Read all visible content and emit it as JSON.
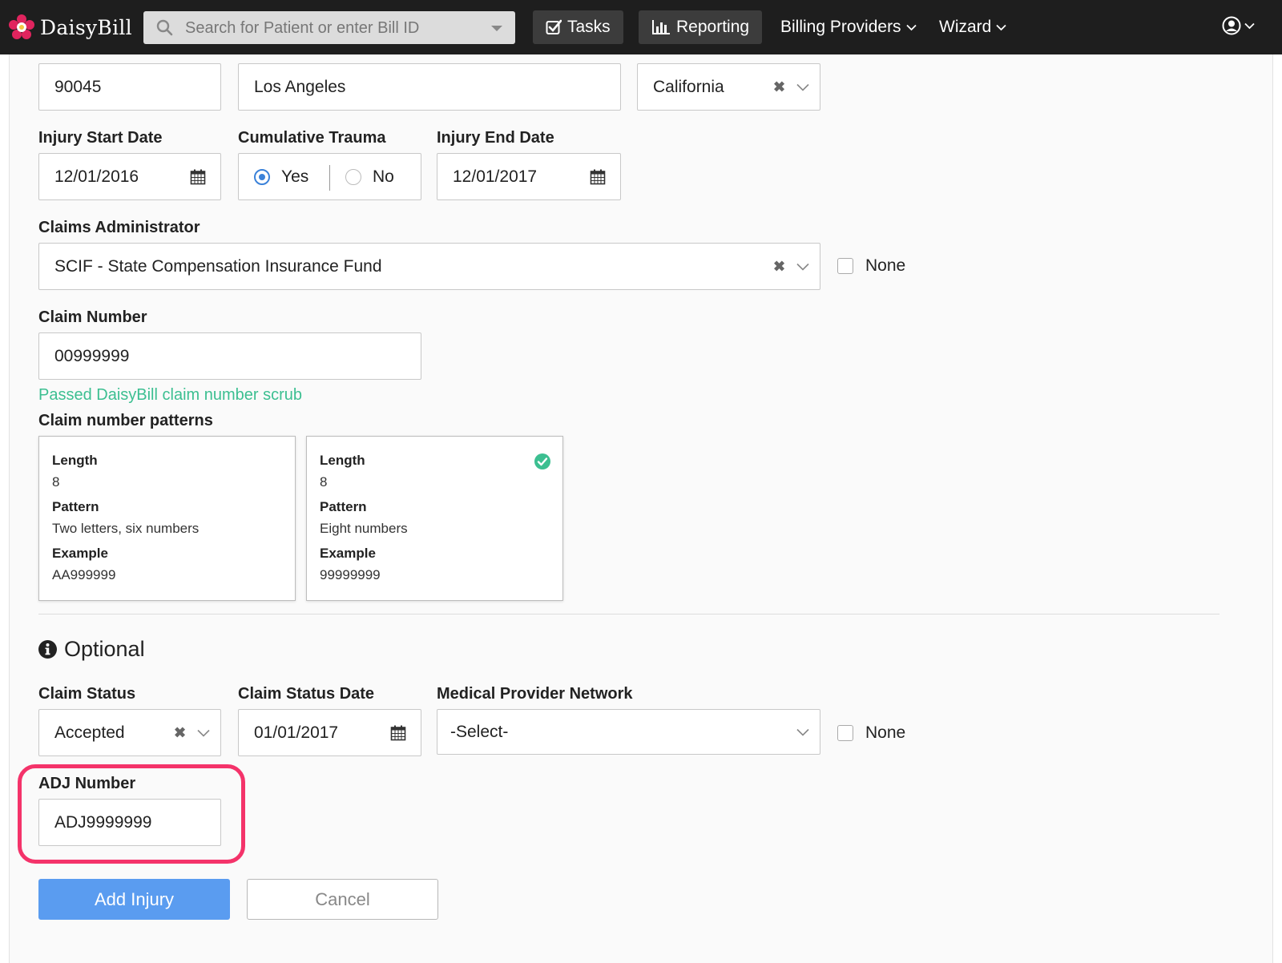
{
  "navbar": {
    "brand": "DaisyBill",
    "search_placeholder": "Search for Patient or enter Bill ID",
    "tasks_label": "Tasks",
    "reporting_label": "Reporting",
    "billing_providers_label": "Billing Providers",
    "wizard_label": "Wizard"
  },
  "address": {
    "zip": "90045",
    "city": "Los Angeles",
    "state": "California"
  },
  "injury": {
    "start_date_label": "Injury Start Date",
    "start_date": "12/01/2016",
    "cumulative_label": "Cumulative Trauma",
    "yes_label": "Yes",
    "no_label": "No",
    "end_date_label": "Injury End Date",
    "end_date": "12/01/2017"
  },
  "claims_admin": {
    "label": "Claims Administrator",
    "value": "SCIF - State Compensation Insurance Fund",
    "none_label": "None"
  },
  "claim_number": {
    "label": "Claim Number",
    "value": "00999999",
    "scrub_message": "Passed DaisyBill claim number scrub",
    "patterns_label": "Claim number patterns",
    "patterns": [
      {
        "length_label": "Length",
        "length": "8",
        "pattern_label": "Pattern",
        "pattern": "Two letters, six numbers",
        "example_label": "Example",
        "example": "AA999999",
        "matched": false
      },
      {
        "length_label": "Length",
        "length": "8",
        "pattern_label": "Pattern",
        "pattern": "Eight numbers",
        "example_label": "Example",
        "example": "99999999",
        "matched": true
      }
    ]
  },
  "optional": {
    "heading": "Optional",
    "claim_status_label": "Claim Status",
    "claim_status": "Accepted",
    "claim_status_date_label": "Claim Status Date",
    "claim_status_date": "01/01/2017",
    "mpn_label": "Medical Provider Network",
    "mpn_value": "-Select-",
    "mpn_none_label": "None",
    "adj_label": "ADJ Number",
    "adj_value": "ADJ9999999"
  },
  "actions": {
    "add_label": "Add Injury",
    "cancel_label": "Cancel"
  },
  "colors": {
    "navbar_bg": "#1e1e1e",
    "accent_blue": "#5a9cf0",
    "success_green": "#3cbf91",
    "highlight_pink": "#f4336a"
  }
}
